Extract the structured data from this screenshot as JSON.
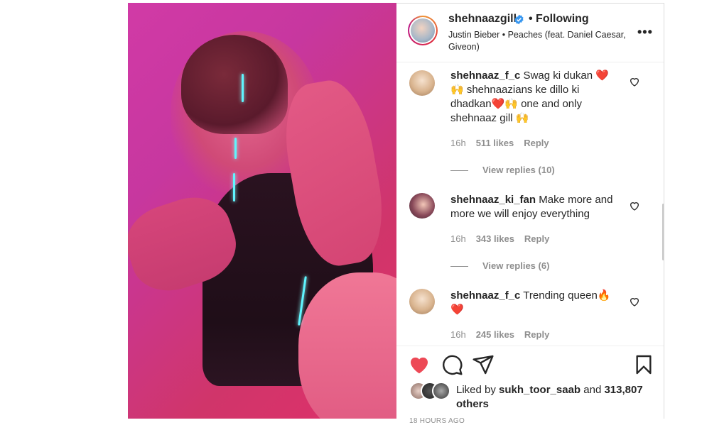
{
  "post": {
    "username": "shehnaazgill",
    "follow_status": "• Following",
    "song": "Justin Bieber • Peaches (feat. Daniel Caesar, Giveon)",
    "more_label": "•••"
  },
  "comments": [
    {
      "user": "shehnaaz_f_c",
      "text": " Swag ki dukan ❤️ 🙌 shehnaazians ke dillo ki dhadkan❤️🙌 one and only shehnaaz gill 🙌",
      "time": "16h",
      "likes": "511 likes",
      "reply": "Reply",
      "view_replies": "View replies (10)"
    },
    {
      "user": "shehnaaz_ki_fan",
      "text": " Make more and more we will enjoy everything",
      "time": "16h",
      "likes": "343 likes",
      "reply": "Reply",
      "view_replies": "View replies (6)"
    },
    {
      "user": "shehnaaz_f_c",
      "text": " Trending queen🔥❤️",
      "time": "16h",
      "likes": "245 likes",
      "reply": "Reply"
    }
  ],
  "actions": {
    "liked_prefix": "Liked by ",
    "liked_user": "sukh_toor_saab",
    "liked_and": " and",
    "liked_count": "313,807 others",
    "time_ago": "18 HOURS AGO"
  },
  "icons": {
    "like": "heart-filled-icon",
    "comment": "comment-icon",
    "share": "share-icon",
    "save": "bookmark-icon",
    "verified": "verified-badge-icon"
  },
  "colors": {
    "like_red": "#ed4956",
    "verified_blue": "#3897f0",
    "meta_gray": "#8e8e8e"
  }
}
